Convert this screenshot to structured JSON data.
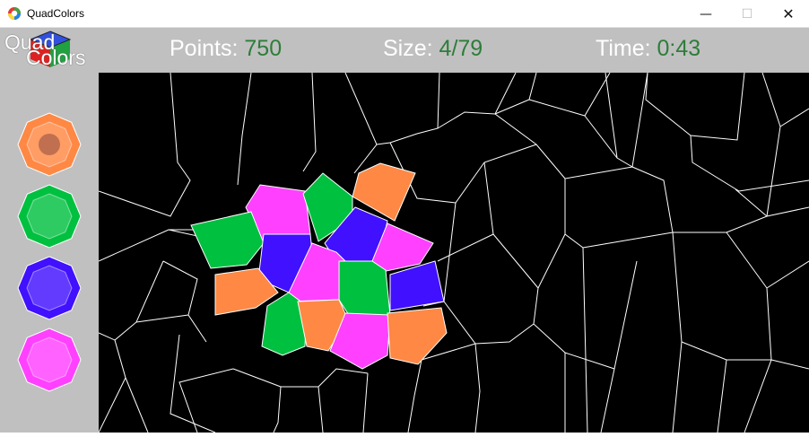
{
  "window": {
    "title": "QuadColors",
    "minimize_symbol": "—",
    "maximize_symbol": "☐",
    "close_symbol": "✕"
  },
  "logo": {
    "line1": "Quad",
    "line2": "Colors"
  },
  "stats": {
    "points_label": "Points:",
    "points_value": "750",
    "size_label": "Size:",
    "size_value": "4/79",
    "time_label": "Time:",
    "time_value": "0:43"
  },
  "palette": {
    "colors": [
      "#ff8844",
      "#00c040",
      "#4010ff",
      "#ff40ff"
    ],
    "selected": 0
  }
}
